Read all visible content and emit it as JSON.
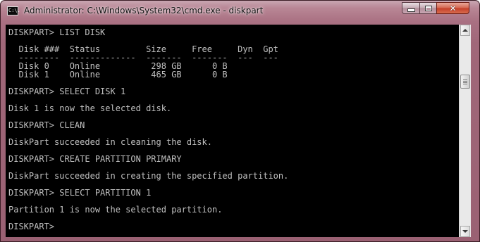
{
  "window": {
    "title": "Administrator: C:\\Windows\\System32\\cmd.exe - diskpart",
    "app_icon": {
      "name": "cmd-icon",
      "text": "C:\\."
    },
    "controls": {
      "minimize": "minimize",
      "maximize": "maximize",
      "close": "✕"
    }
  },
  "console": {
    "foreground": "#c0c0c0",
    "background": "#000000",
    "lines": [
      "DISKPART> LIST DISK",
      "",
      "  Disk ###  Status         Size     Free     Dyn  Gpt",
      "  --------  -------------  -------  -------  ---  ---",
      "  Disk 0    Online          298 GB      0 B",
      "  Disk 1    Online          465 GB      0 B",
      "",
      "DISKPART> SELECT DISK 1",
      "",
      "Disk 1 is now the selected disk.",
      "",
      "DISKPART> CLEAN",
      "",
      "DiskPart succeeded in cleaning the disk.",
      "",
      "DISKPART> CREATE PARTITION PRIMARY",
      "",
      "DiskPart succeeded in creating the specified partition.",
      "",
      "DISKPART> SELECT PARTITION 1",
      "",
      "Partition 1 is now the selected partition.",
      "",
      "DISKPART> "
    ]
  },
  "scrollbar": {
    "position_fraction": 0.22
  }
}
